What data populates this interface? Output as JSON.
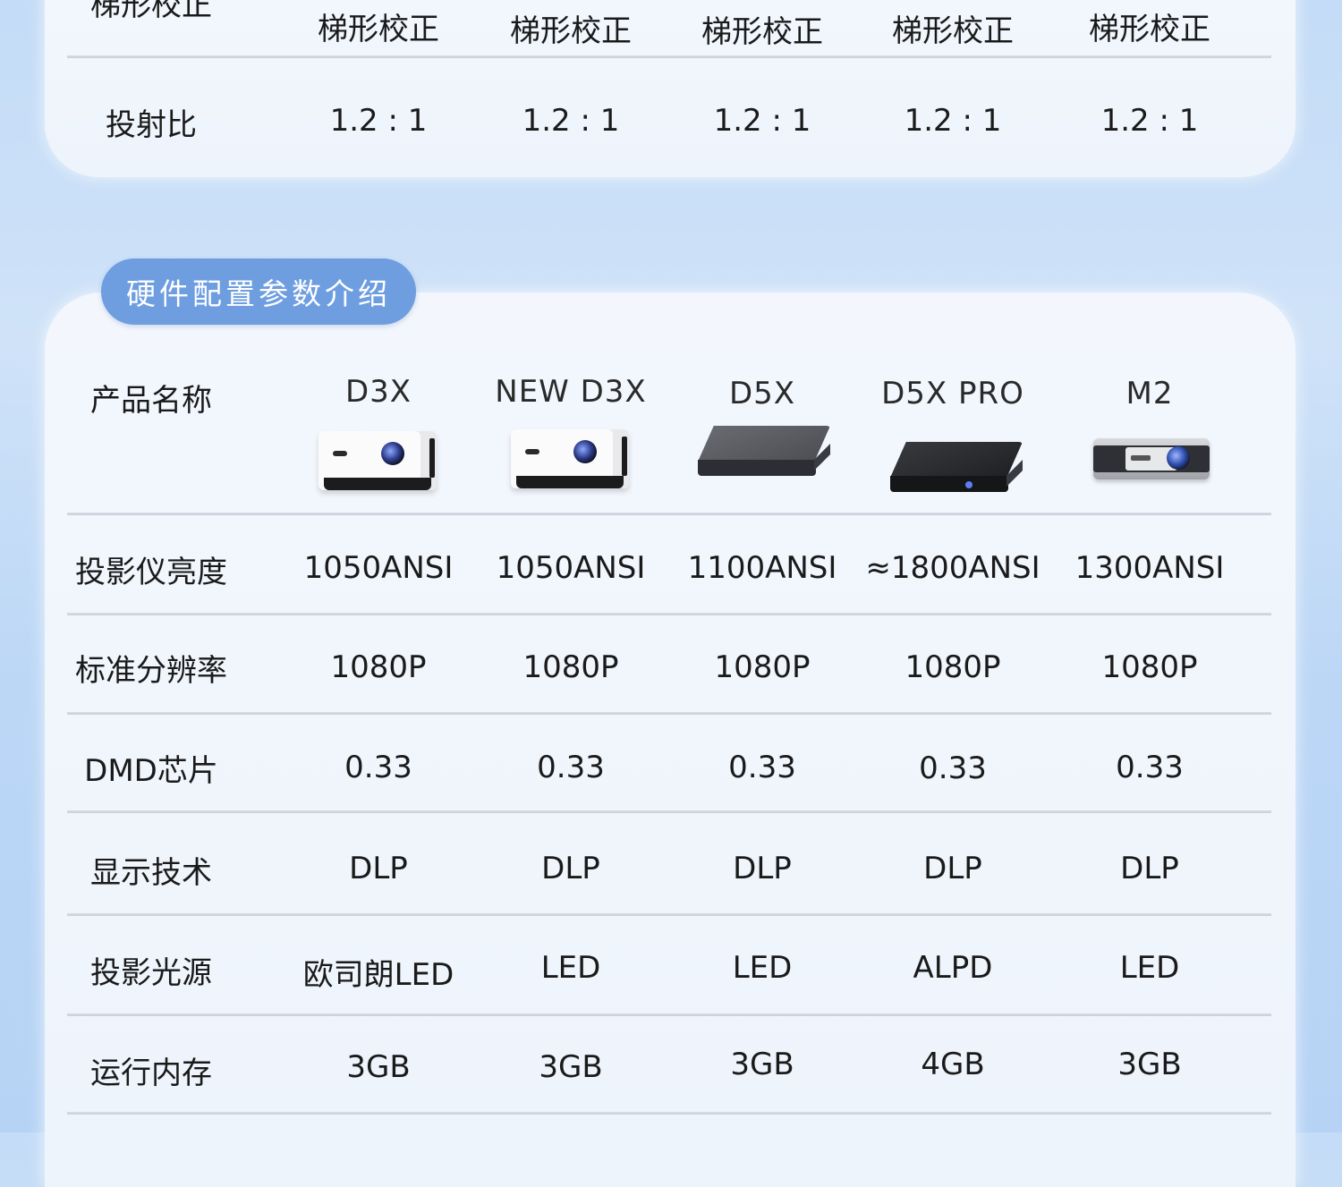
{
  "top_section": {
    "partial_label": "梯形校正",
    "keystone_values": [
      "梯形校正",
      "梯形校正",
      "梯形校正",
      "梯形校正",
      "梯形校正"
    ],
    "throw_ratio": {
      "label": "投射比",
      "values": [
        "1.2 : 1",
        "1.2 : 1",
        "1.2 : 1",
        "1.2 : 1",
        "1.2 : 1"
      ]
    }
  },
  "hardware_section": {
    "title": "硬件配置参数介绍",
    "product_row": {
      "label": "产品名称",
      "products": [
        {
          "name": "D3X",
          "image": "white-cube-projector"
        },
        {
          "name": "NEW D3X",
          "image": "white-cube-projector"
        },
        {
          "name": "D5X",
          "image": "gray-flat-projector"
        },
        {
          "name": "D5X PRO",
          "image": "black-flat-projector"
        },
        {
          "name": "M2",
          "image": "silver-compact-projector"
        }
      ]
    },
    "rows": [
      {
        "label": "投影仪亮度",
        "values": [
          "1050ANSI",
          "1050ANSI",
          "1100ANSI",
          "≈1800ANSI",
          "1300ANSI"
        ]
      },
      {
        "label": "标准分辨率",
        "values": [
          "1080P",
          "1080P",
          "1080P",
          "1080P",
          "1080P"
        ]
      },
      {
        "label": "DMD芯片",
        "values": [
          "0.33",
          "0.33",
          "0.33",
          "0.33",
          "0.33"
        ]
      },
      {
        "label": "显示技术",
        "values": [
          "DLP",
          "DLP",
          "DLP",
          "DLP",
          "DLP"
        ]
      },
      {
        "label": "投影光源",
        "values": [
          "欧司朗LED",
          "LED",
          "LED",
          "ALPD",
          "LED"
        ]
      },
      {
        "label": "运行内存",
        "values": [
          "3GB",
          "3GB",
          "3GB",
          "4GB",
          "3GB"
        ]
      }
    ]
  }
}
